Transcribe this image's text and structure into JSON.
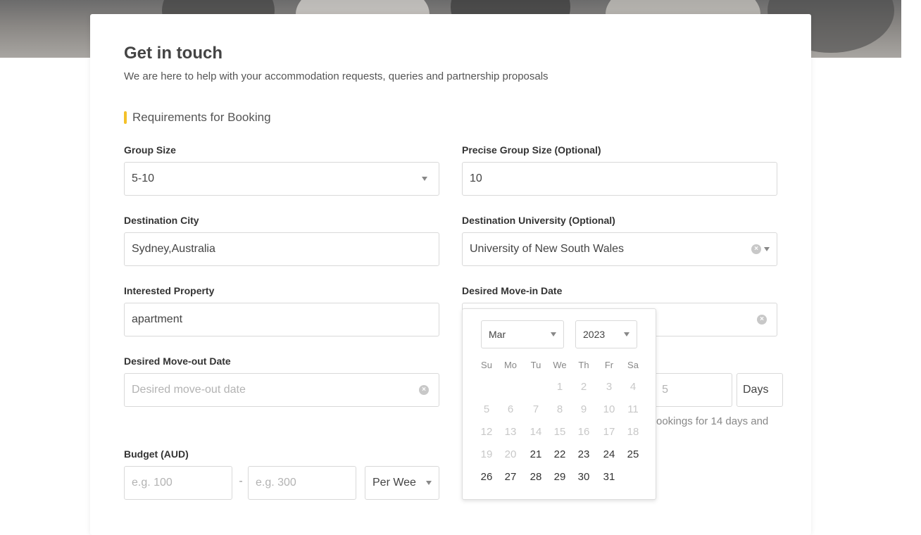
{
  "page": {
    "title": "Get in touch",
    "subtitle": "We are here to help with your accommodation requests, queries and partnership proposals",
    "section_title": "Requirements for Booking"
  },
  "fields": {
    "group_size": {
      "label": "Group Size",
      "value": "5-10"
    },
    "precise_group_size": {
      "label": "Precise Group Size (Optional)",
      "value": "10"
    },
    "destination_city": {
      "label": "Destination City",
      "value": "Sydney,Australia"
    },
    "destination_university": {
      "label": "Destination University (Optional)",
      "value": "University of New South Wales"
    },
    "interested_property": {
      "label": "Interested Property",
      "value": "apartment"
    },
    "move_in_date": {
      "label": "Desired Move-in Date"
    },
    "move_out_date": {
      "label": "Desired Move-out Date",
      "placeholder": "Desired move-out date"
    },
    "stay_length": {
      "value_partial": "5",
      "unit": "Days"
    },
    "stay_note": "ookings for 14 days and",
    "budget": {
      "label": "Budget (AUD)",
      "min_placeholder": "e.g. 100",
      "separator": "-",
      "max_placeholder": "e.g. 300",
      "period": "Per Wee"
    }
  },
  "datepicker": {
    "month": "Mar",
    "year": "2023",
    "weekdays": [
      "Su",
      "Mo",
      "Tu",
      "We",
      "Th",
      "Fr",
      "Sa"
    ],
    "weeks": [
      [
        null,
        null,
        null,
        "1",
        "2",
        "3",
        "4"
      ],
      [
        "5",
        "6",
        "7",
        "8",
        "9",
        "10",
        "11"
      ],
      [
        "12",
        "13",
        "14",
        "15",
        "16",
        "17",
        "18"
      ],
      [
        "19",
        "20",
        "21",
        "22",
        "23",
        "24",
        "25"
      ],
      [
        "26",
        "27",
        "28",
        "29",
        "30",
        "31",
        null
      ]
    ],
    "first_selectable": 21
  },
  "icons": {
    "caret": "chevron-down-icon",
    "clear": "clear-circle-icon"
  },
  "colors": {
    "accent": "#f4c12a"
  }
}
